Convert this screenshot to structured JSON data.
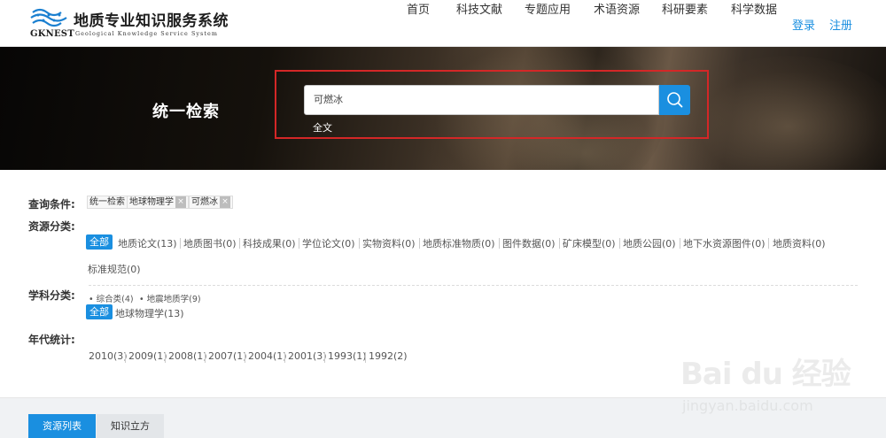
{
  "header": {
    "logo_abbr": "GKNEST",
    "logo_title": "地质专业知识服务系统",
    "logo_subtitle": "Geological Knowledge Service System",
    "nav": [
      "首页",
      "科技文献",
      "专题应用",
      "术语资源",
      "科研要素",
      "科学数据"
    ],
    "login": "登录",
    "register": "注册"
  },
  "banner": {
    "title": "统一检索",
    "search_value": "可燃冰",
    "scope": "全文"
  },
  "filters": {
    "conditions_label": "查询条件:",
    "conditions": [
      "统一检索",
      "地球物理学",
      "可燃冰"
    ],
    "remove_glyph": "×",
    "resource_label": "资源分类:",
    "all_label": "全部",
    "resource_row1": [
      "地质论文(13)",
      "地质图书(0)",
      "科技成果(0)",
      "学位论文(0)",
      "实物资料(0)",
      "地质标准物质(0)",
      "图件数据(0)",
      "矿床模型(0)",
      "地质公园(0)",
      "地下水资源图件(0)",
      "地质资料(0)"
    ],
    "resource_row2": [
      "标准规范(0)"
    ],
    "subject_label": "学科分类:",
    "subject_bullets": [
      "综合类(4)",
      "地震地质学(9)"
    ],
    "subject_selected": "地球物理学(13)",
    "year_label": "年代统计:",
    "years": [
      "2010(3)",
      "2009(1)",
      "2008(1)",
      "2007(1)",
      "2004(1)",
      "2001(3)",
      "1993(1)",
      "1992(2)"
    ]
  },
  "tabs": [
    "资源列表",
    "知识立方"
  ],
  "watermark": {
    "text": "Bai du 经验",
    "url": "jingyan.baidu.com"
  },
  "colors": {
    "accent": "#1a8fe0",
    "highlight": "#d42727"
  }
}
